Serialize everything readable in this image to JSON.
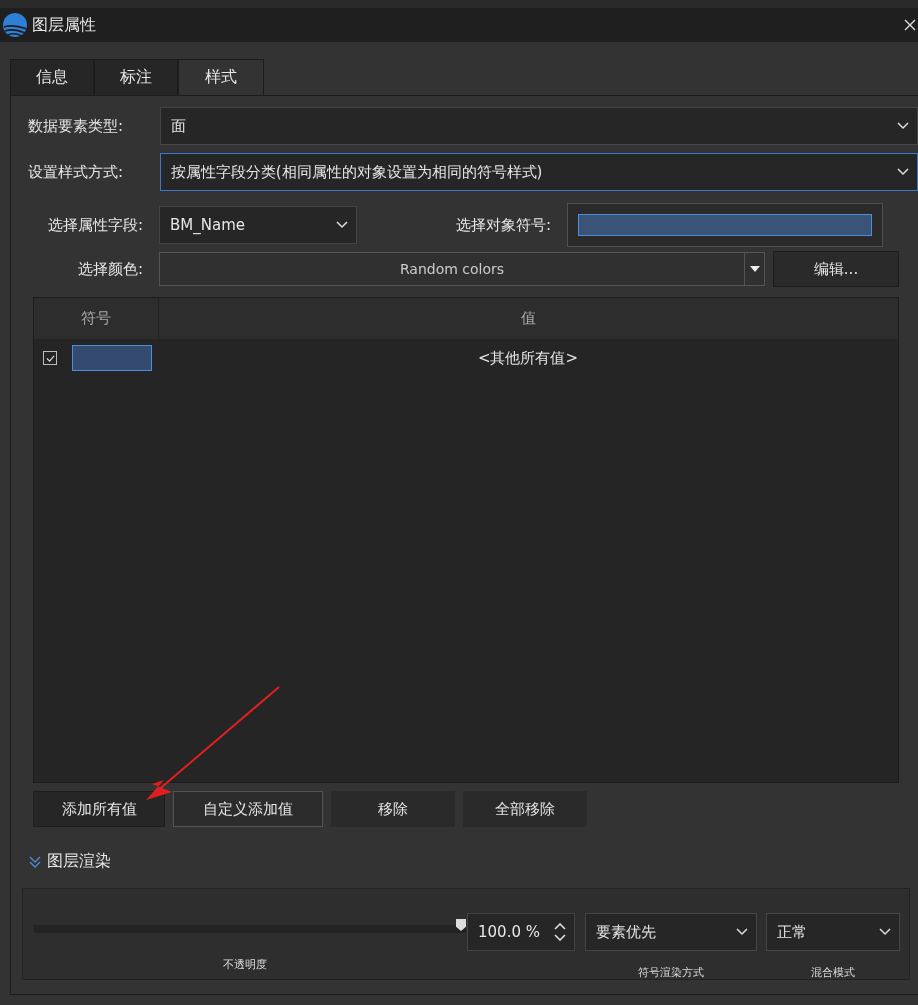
{
  "window": {
    "title": "图层属性"
  },
  "tabs": [
    {
      "label": "信息",
      "selected": false
    },
    {
      "label": "标注",
      "selected": false
    },
    {
      "label": "样式",
      "selected": true
    }
  ],
  "feature_type": {
    "label": "数据要素类型:",
    "value": "面"
  },
  "style_method": {
    "label": "设置样式方式:",
    "value": "按属性字段分类(相同属性的对象设置为相同的符号样式)"
  },
  "attribute_field": {
    "label": "选择属性字段:",
    "value": "BM_Name"
  },
  "object_symbol": {
    "label": "选择对象符号:"
  },
  "color_scheme": {
    "label": "选择颜色:",
    "value": "Random colors",
    "edit_button": "编辑..."
  },
  "table": {
    "columns": [
      "符号",
      "值"
    ],
    "rows": [
      {
        "checked": true,
        "value": "<其他所有值>"
      }
    ]
  },
  "buttons": [
    {
      "label": "添加所有值",
      "kind": "dark"
    },
    {
      "label": "自定义添加值",
      "kind": "outlined"
    },
    {
      "label": "移除",
      "kind": "plain"
    },
    {
      "label": "全部移除",
      "kind": "plain"
    }
  ],
  "render_section": {
    "title": "图层渲染",
    "expanded": true,
    "opacity": {
      "level": 1.0,
      "value": "100.0 %",
      "caption": "不透明度"
    },
    "symbol_render": {
      "value": "要素优先",
      "caption": "符号渲染方式"
    },
    "blend_mode": {
      "value": "正常",
      "caption": "混合模式"
    }
  }
}
